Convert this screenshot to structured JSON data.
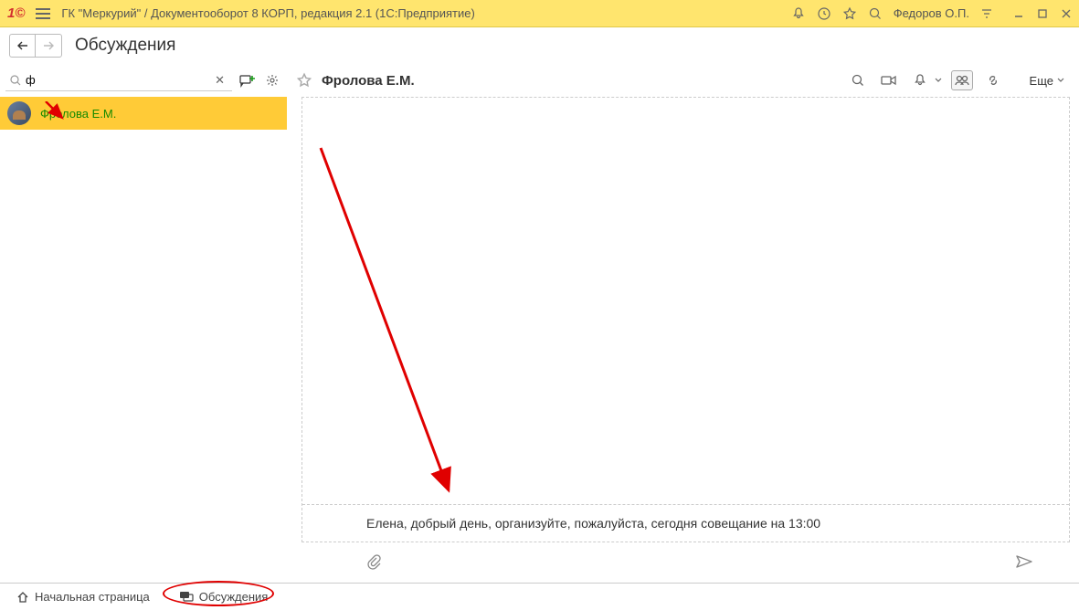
{
  "titlebar": {
    "app_name": "ГК \"Меркурий\" / Документооборот 8 КОРП, редакция 2.1  (1С:Предприятие)",
    "user": "Федоров О.П."
  },
  "page": {
    "title": "Обсуждения"
  },
  "search": {
    "value": "ф"
  },
  "contacts": [
    {
      "name": "Фролова Е.М."
    }
  ],
  "chat": {
    "title": "Фролова Е.М.",
    "more_label": "Еще",
    "input_value": "Елена, добрый день, организуйте, пожалуйста, сегодня совещание на 13:00"
  },
  "bottom_tabs": {
    "home": "Начальная страница",
    "discussions": "Обсуждения"
  },
  "icons": {
    "bell": "bell-icon",
    "history": "history-icon",
    "star": "star-icon",
    "search": "search-icon",
    "filter": "filter-icon",
    "minimize": "minimize-icon",
    "maximize": "maximize-icon",
    "close": "close-icon",
    "gear": "gear-icon",
    "add": "add-conversation-icon",
    "video": "video-icon",
    "call": "call-icon",
    "bell2": "bell-icon",
    "group": "group-icon",
    "link": "link-icon",
    "attach": "paperclip-icon",
    "send": "send-icon",
    "home": "home-icon",
    "chat": "chat-icon"
  }
}
